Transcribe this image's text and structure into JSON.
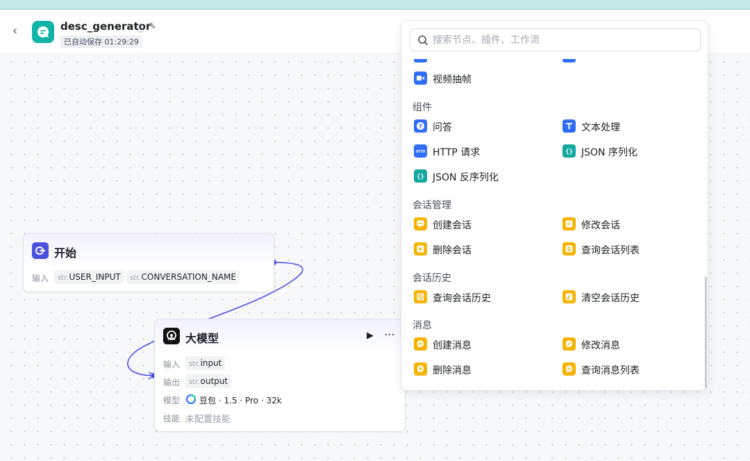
{
  "header": {
    "back_glyph": "‹",
    "title": "desc_generator",
    "autosave": "已自动保存 01:29:29"
  },
  "nodes": {
    "start": {
      "title": "开始",
      "input_label": "输入",
      "inputs": [
        {
          "type": "str.",
          "name": "USER_INPUT"
        },
        {
          "type": "str.",
          "name": "CONVERSATION_NAME"
        }
      ]
    },
    "llm": {
      "title": "大模型",
      "input_label": "输入",
      "input": {
        "type": "str.",
        "name": "input"
      },
      "output_label": "输出",
      "output": {
        "type": "str.",
        "name": "output"
      },
      "model_label": "模型",
      "model": "豆包 · 1.5 · Pro · 32k",
      "skill_label": "技能",
      "skill": "未配置技能"
    }
  },
  "panel": {
    "search_placeholder": "搜索节点、插件、工作流",
    "video_item": "视频抽帧",
    "sections": {
      "components": "组件",
      "conversation_mgmt": "会话管理",
      "conversation_history": "会话历史",
      "messages": "消息"
    },
    "items": {
      "qa": "问答",
      "text_processing": "文本处理",
      "http_request": "HTTP 请求",
      "json_serialize": "JSON 序列化",
      "json_deserialize": "JSON 反序列化",
      "create_conversation": "创建会话",
      "modify_conversation": "修改会话",
      "delete_conversation": "删除会话",
      "query_conversation_list": "查询会话列表",
      "query_conversation_history": "查询会话历史",
      "clear_conversation_history": "清空会话历史",
      "create_message": "创建消息",
      "modify_message": "修改消息",
      "delete_message": "删除消息",
      "query_message_list": "查询消息列表"
    }
  },
  "colors": {
    "accent": "#4b4fe0",
    "app_icon": "#12b3a8",
    "icon_blue": "#2f6df6",
    "icon_teal": "#13a89e",
    "icon_yellow": "#f4b400"
  }
}
